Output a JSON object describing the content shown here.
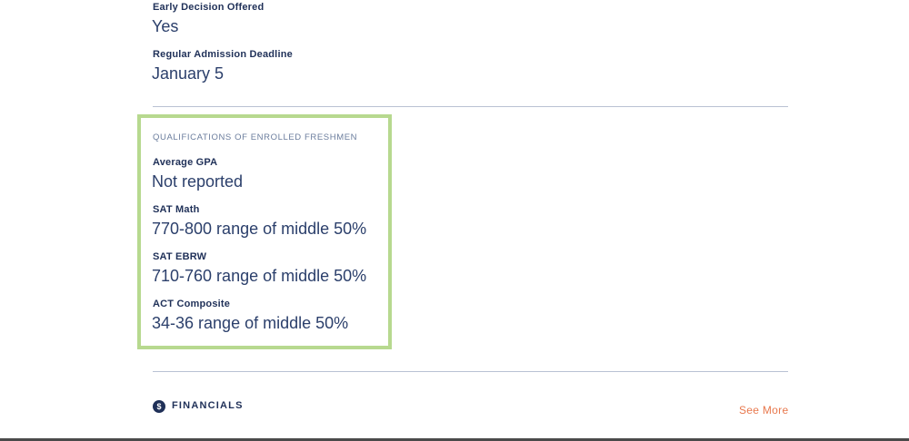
{
  "admissions": {
    "early_decision_label": "Early Decision Offered",
    "early_decision_value": "Yes",
    "regular_deadline_label": "Regular Admission Deadline",
    "regular_deadline_value": "January 5"
  },
  "qualifications": {
    "heading": "QUALIFICATIONS OF ENROLLED FRESHMEN",
    "items": [
      {
        "label": "Average GPA",
        "value": "Not reported"
      },
      {
        "label": "SAT Math",
        "value": "770-800 range of middle 50%"
      },
      {
        "label": "SAT EBRW",
        "value": "710-760 range of middle 50%"
      },
      {
        "label": "ACT Composite",
        "value": "34-36 range of middle 50%"
      }
    ]
  },
  "financials": {
    "icon_glyph": "$",
    "icon": "dollar-circle-icon",
    "label": "FINANCIALS",
    "see_more": "See More"
  },
  "colors": {
    "text_dark": "#1f3058",
    "highlight_border": "#b7d98f",
    "accent_link": "#e8784d"
  }
}
